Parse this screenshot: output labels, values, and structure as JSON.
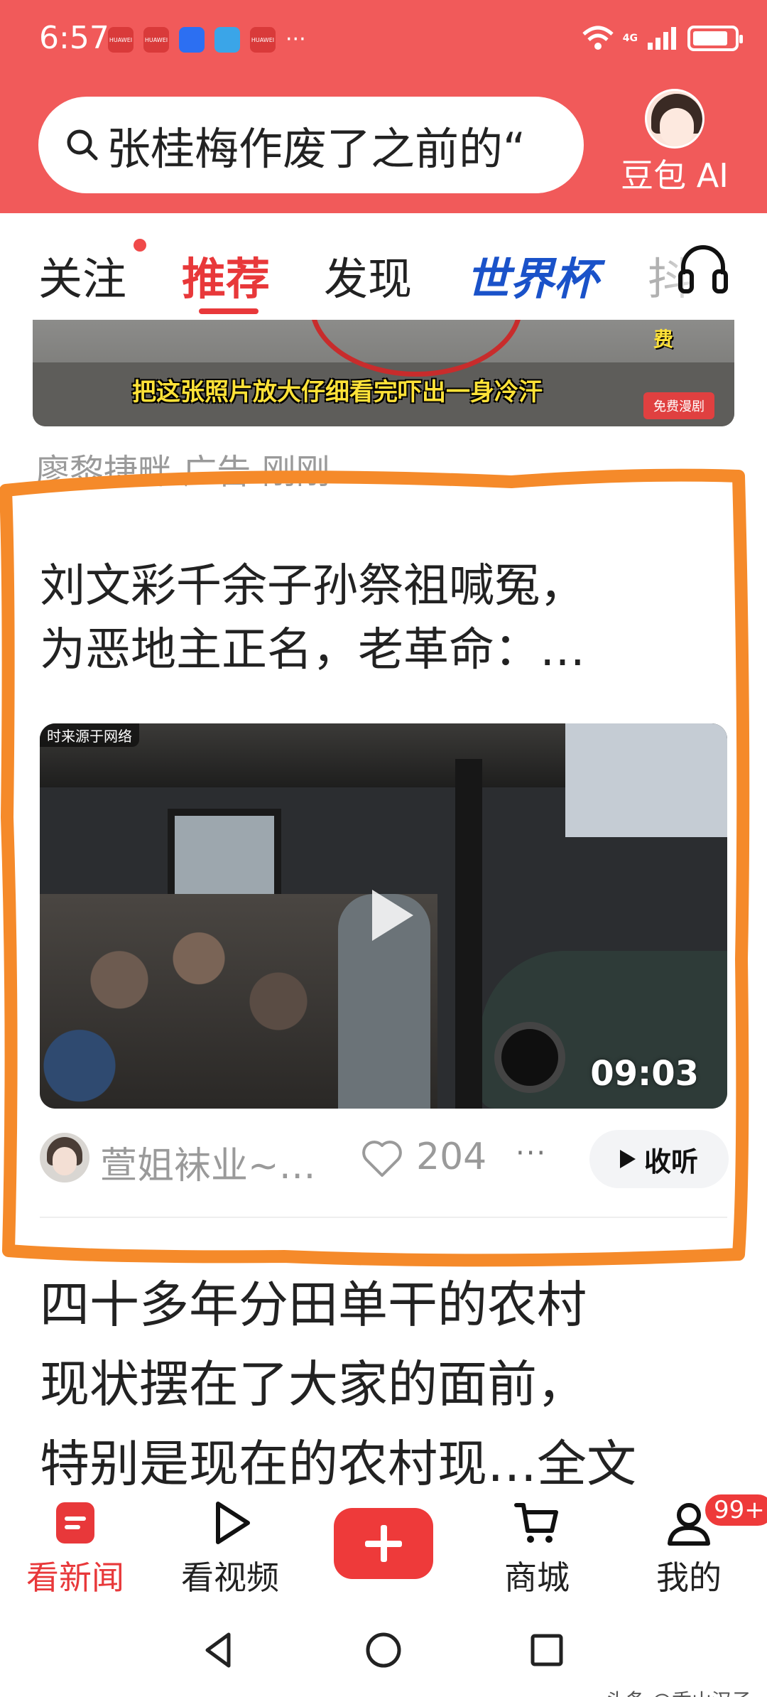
{
  "status_bar": {
    "time": "6:57",
    "app_icons": [
      "HUAWEI",
      "HUAWEI",
      "",
      "",
      "HUAWEI"
    ],
    "more": "···",
    "network": "4G",
    "battery_level": 0.85
  },
  "search": {
    "query": "张桂梅作废了之前的“",
    "ai_label": "豆包 AI"
  },
  "tabs": [
    {
      "label": "关注",
      "has_dot": true
    },
    {
      "label": "推荐",
      "active": true
    },
    {
      "label": "发现"
    },
    {
      "label": "世界杯"
    },
    {
      "label": "抖"
    }
  ],
  "ad": {
    "side_text": "费",
    "caption": "把这张照片放大仔细看完吓出一身冷汗",
    "badge": "免费漫剧",
    "meta": "廖黎捷畔 广告 刚刚"
  },
  "article": {
    "title_line1": "刘文彩千余子孙祭祖喊冤，",
    "title_line2": "为恶地主正名，老革命：…",
    "source_tag": "时来源于网络",
    "duration": "09:03",
    "author": "萱姐袜业~…",
    "likes": "204",
    "more": "···",
    "listen_label": "收听"
  },
  "next_article": {
    "line1": "四十多年分田单干的农村",
    "line2": "现状摆在了大家的面前，",
    "line3": "特别是现在的农村现…全文"
  },
  "bottom_nav": [
    {
      "label": "看新闻",
      "icon": "news-icon",
      "active": true
    },
    {
      "label": "看视频",
      "icon": "play-outline-icon"
    },
    {
      "label": "",
      "icon": "plus-icon"
    },
    {
      "label": "商城",
      "icon": "cart-icon"
    },
    {
      "label": "我的",
      "icon": "person-icon"
    }
  ],
  "badge": "99+",
  "watermark": "头条 @香山汉子",
  "colors": {
    "brand_red": "#f15a5a",
    "accent_red": "#e8383a",
    "highlight_orange": "#f58a2a",
    "world_cup_blue": "#1a52c9"
  }
}
